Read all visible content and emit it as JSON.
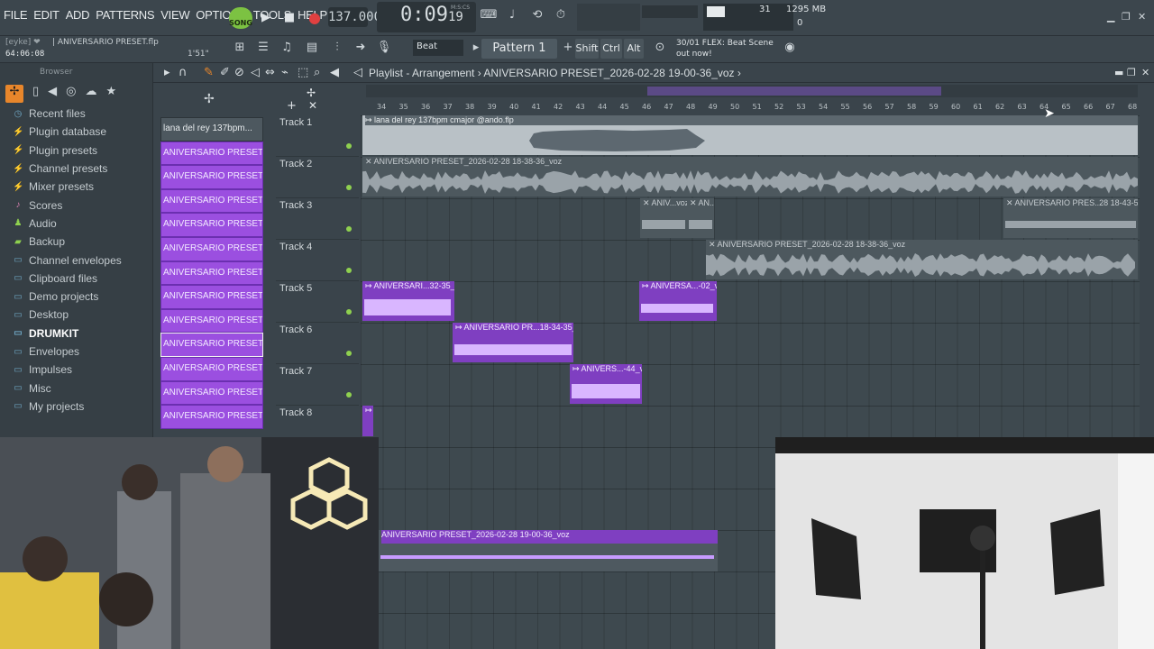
{
  "menu": [
    "FILE",
    "EDIT",
    "ADD",
    "PATTERNS",
    "VIEW",
    "OPTIONS",
    "TOOLS",
    "HELP"
  ],
  "transport": {
    "song_mode": "SONG",
    "tempo": "137.000",
    "time": "0:09",
    "time_frac": "19",
    "time_unit_label": "M:S:CS"
  },
  "status": {
    "cpu": "31",
    "memory": "1295 MB",
    "polyphony": "0"
  },
  "project": {
    "user": "[eyke] ❤",
    "filename": "| ANIVERSARIO PRESET.flp",
    "clock": "64:06:08",
    "duration": "1'51\""
  },
  "toolbar2": {
    "snap": "Beat",
    "pattern": "Pattern 1",
    "shift": "Shift",
    "ctrl": "Ctrl",
    "alt": "Alt",
    "news_line1": "30/01  FLEX: Beat Scene",
    "news_line2": "out now!"
  },
  "browser": {
    "title": "Browser",
    "items": [
      {
        "label": "Recent files",
        "icon": "clock-icon"
      },
      {
        "label": "Plugin database",
        "icon": "plug-icon"
      },
      {
        "label": "Plugin presets",
        "icon": "plug-icon"
      },
      {
        "label": "Channel presets",
        "icon": "plug-icon"
      },
      {
        "label": "Mixer presets",
        "icon": "plug-icon"
      },
      {
        "label": "Scores",
        "icon": "note-icon"
      },
      {
        "label": "Audio",
        "icon": "person-icon"
      },
      {
        "label": "Backup",
        "icon": "folder-icon"
      },
      {
        "label": "Channel envelopes",
        "icon": "folder-icon"
      },
      {
        "label": "Clipboard files",
        "icon": "folder-icon"
      },
      {
        "label": "Demo projects",
        "icon": "folder-icon"
      },
      {
        "label": "Desktop",
        "icon": "folder-icon"
      },
      {
        "label": "DRUMKIT",
        "icon": "folder-icon"
      },
      {
        "label": "Envelopes",
        "icon": "folder-icon"
      },
      {
        "label": "Impulses",
        "icon": "folder-icon"
      },
      {
        "label": "Misc",
        "icon": "folder-icon"
      },
      {
        "label": "My projects",
        "icon": "folder-icon"
      }
    ]
  },
  "playlist": {
    "title": "Playlist - Arrangement",
    "path": "ANIVERSARIO PRESET_2026-02-28 19-00-36_voz",
    "picker": [
      "lana del rey 137bpm...",
      "ANIVERSARIO PRESET_202...",
      "ANIVERSARIO PRESET_202...",
      "ANIVERSARIO PRESET_202...",
      "ANIVERSARIO PRESET_202...",
      "ANIVERSARIO PRESET_202...",
      "ANIVERSARIO PRESET_202...",
      "ANIVERSARIO PRESET_202...",
      "ANIVERSARIO PRESET_202...",
      "ANIVERSARIO PRESET_202...",
      "ANIVERSARIO PRESET_202...",
      "ANIVERSARIO PRESET_202...",
      "ANIVERSARIO PRESET_202..."
    ],
    "tracks": [
      "Track 1",
      "Track 2",
      "Track 3",
      "Track 4",
      "Track 5",
      "Track 6",
      "Track 7",
      "Track 8"
    ],
    "ruler": [
      "34",
      "35",
      "36",
      "37",
      "38",
      "39",
      "40",
      "41",
      "42",
      "43",
      "44",
      "45",
      "46",
      "47",
      "48",
      "49",
      "50",
      "51",
      "52",
      "53",
      "54",
      "55",
      "56",
      "57",
      "58",
      "59",
      "60",
      "61",
      "62",
      "63",
      "64",
      "65",
      "66",
      "67",
      "68"
    ],
    "clips": {
      "t1": "↦ lana del rey 137bpm cmajor @ando.flp",
      "t2": "✕ ANIVERSARIO PRESET_2026-02-28 18-38-36_voz",
      "t3a": "✕ ANIV...voz",
      "t3b": "✕ AN...2",
      "t3c": "✕ ANIVERSARIO PRES..28 18-43-50_voz",
      "t4": "✕ ANIVERSARIO PRESET_2026-02-28 18-38-36_voz",
      "t5a": "↦ ANIVERSARI...32-35_voz",
      "t5b": "↦ ANIVERSA...-02_voz",
      "t6": "↦ ANIVERSARIO PR...18-34-35_voz",
      "t7": "↦ ANIVERS...-44_voz",
      "t8": "↦",
      "bottom": "ANIVERSARIO PRESET_2026-02-28 19-00-36_voz"
    }
  }
}
